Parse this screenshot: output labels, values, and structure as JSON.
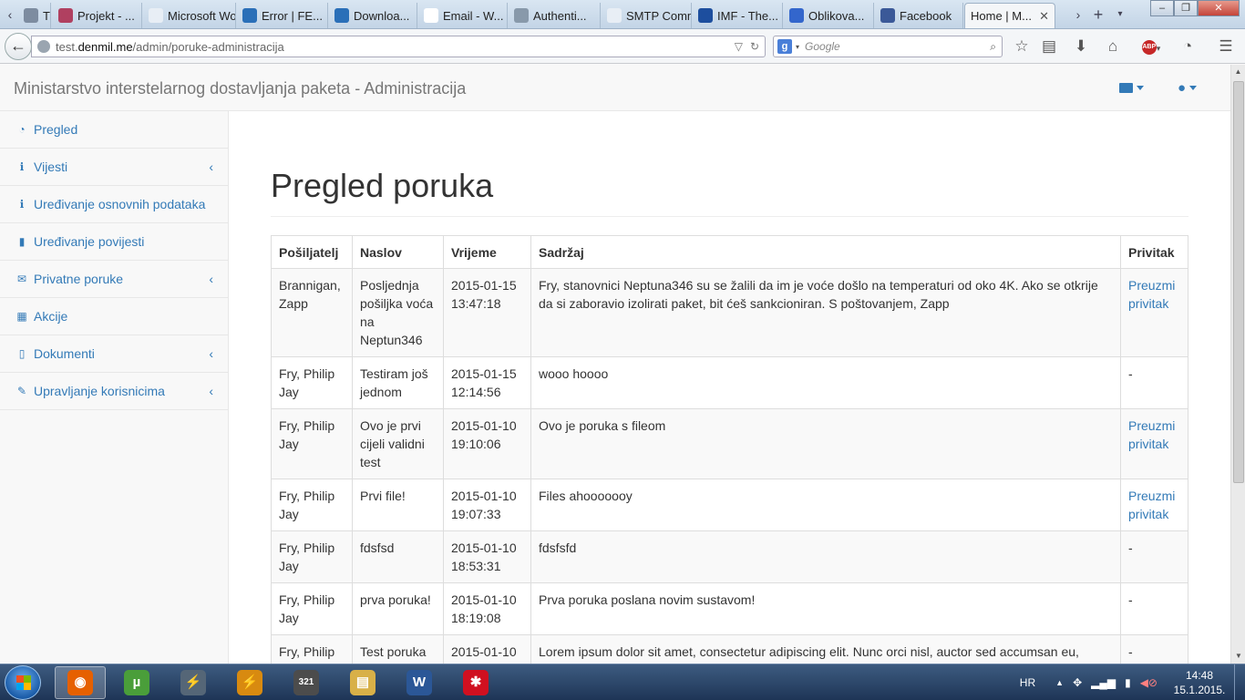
{
  "browser": {
    "tabs": [
      {
        "label": "Tr...",
        "icon": "generic-page-icon",
        "color": "#7d8ca0"
      },
      {
        "label": "Projekt - ...",
        "icon": "gear-icon",
        "color": "#b04060"
      },
      {
        "label": "Microsoft Wo...",
        "icon": "blank-page-icon",
        "color": "#e8eef5"
      },
      {
        "label": "Error | FE...",
        "icon": "circle-logo-icon",
        "color": "#2a6fb8"
      },
      {
        "label": "Downloa...",
        "icon": "circle-logo-icon",
        "color": "#2a6fb8"
      },
      {
        "label": "Email - W...",
        "icon": "wikipedia-icon",
        "color": "#ffffff"
      },
      {
        "label": "Authenti...",
        "icon": "tool-icon",
        "color": "#8899aa"
      },
      {
        "label": "SMTP Comm...",
        "icon": "blank-page-icon",
        "color": "#e8eef5"
      },
      {
        "label": "IMF - The...",
        "icon": "shark-fin-icon",
        "color": "#1d4e9e"
      },
      {
        "label": "Oblikova...",
        "icon": "f2-icon",
        "color": "#3366cc"
      },
      {
        "label": "Facebook",
        "icon": "facebook-icon",
        "color": "#3b5998"
      },
      {
        "label": "Home | M...",
        "icon": "",
        "color": ""
      }
    ],
    "url_prefix": "test.",
    "url_domain": "denmil.me",
    "url_path": "/admin/poruke-administracija",
    "search_placeholder": "Google"
  },
  "app": {
    "brand": "Ministarstvo interstelarnog dostavljanja paketa - Administracija"
  },
  "sidebar": {
    "items": [
      {
        "label": "Pregled",
        "icon": "dashboard-icon",
        "glyph": "◔",
        "expandable": false
      },
      {
        "label": "Vijesti",
        "icon": "info-icon",
        "glyph": "ℹ",
        "expandable": true
      },
      {
        "label": "Uređivanje osnovnih podataka",
        "icon": "info-icon",
        "glyph": "ℹ",
        "expandable": false
      },
      {
        "label": "Uređivanje povijesti",
        "icon": "book-icon",
        "glyph": "▮",
        "expandable": false
      },
      {
        "label": "Privatne poruke",
        "icon": "envelope-icon",
        "glyph": "✉",
        "expandable": true
      },
      {
        "label": "Akcije",
        "icon": "calendar-icon",
        "glyph": "▦",
        "expandable": false
      },
      {
        "label": "Dokumenti",
        "icon": "file-icon",
        "glyph": "▯",
        "expandable": true
      },
      {
        "label": "Upravljanje korisnicima",
        "icon": "wrench-icon",
        "glyph": "✎",
        "expandable": true
      }
    ]
  },
  "main": {
    "title": "Pregled poruka",
    "table": {
      "headers": [
        "Pošiljatelj",
        "Naslov",
        "Vrijeme",
        "Sadržaj",
        "Privitak"
      ],
      "rows": [
        {
          "sender": "Brannigan, Zapp",
          "subject": "Posljednja pošiljka voća na Neptun346",
          "time": "2015-01-15 13:47:18",
          "content": "Fry, stanovnici Neptuna346 su se žalili da im je voće došlo na temperaturi od oko 4K. Ako se otkrije da si zaboravio izolirati paket, bit ćeš sankcioniran. S poštovanjem, Zapp",
          "attachment": "Preuzmi privitak",
          "has_link": true
        },
        {
          "sender": "Fry, Philip Jay",
          "subject": "Testiram još jednom",
          "time": "2015-01-15 12:14:56",
          "content": "wooo hoooo",
          "attachment": "-",
          "has_link": false
        },
        {
          "sender": "Fry, Philip Jay",
          "subject": "Ovo je prvi cijeli validni test",
          "time": "2015-01-10 19:10:06",
          "content": "Ovo je poruka s fileom",
          "attachment": "Preuzmi privitak",
          "has_link": true
        },
        {
          "sender": "Fry, Philip Jay",
          "subject": "Prvi file!",
          "time": "2015-01-10 19:07:33",
          "content": "Files ahooooooy",
          "attachment": "Preuzmi privitak",
          "has_link": true
        },
        {
          "sender": "Fry, Philip Jay",
          "subject": "fdsfsd",
          "time": "2015-01-10 18:53:31",
          "content": "fdsfsfd",
          "attachment": "-",
          "has_link": false
        },
        {
          "sender": "Fry, Philip Jay",
          "subject": "prva poruka!",
          "time": "2015-01-10 18:19:08",
          "content": "Prva poruka poslana novim sustavom!",
          "attachment": "-",
          "has_link": false
        },
        {
          "sender": "Fry, Philip Jay",
          "subject": "Test poruka",
          "time": "2015-01-10",
          "content": "Lorem ipsum dolor sit amet, consectetur adipiscing elit. Nunc orci nisl, auctor sed accumsan eu,",
          "attachment": "-",
          "has_link": false
        }
      ]
    }
  },
  "taskbar": {
    "apps": [
      {
        "name": "firefox-app",
        "glyph": "◉",
        "color": "#e66000"
      },
      {
        "name": "utorrent-app",
        "glyph": "µ",
        "color": "#4a9e3a"
      },
      {
        "name": "network-tool-app",
        "glyph": "⚡",
        "color": "#556677"
      },
      {
        "name": "winamp-app",
        "glyph": "⚡",
        "color": "#d88a10"
      },
      {
        "name": "calendar-app",
        "glyph": "321",
        "color": "#4c4c4c"
      },
      {
        "name": "explorer-app",
        "glyph": "▤",
        "color": "#d8b048"
      },
      {
        "name": "word-app",
        "glyph": "W",
        "color": "#2b5797"
      },
      {
        "name": "splash-app",
        "glyph": "✱",
        "color": "#d01020"
      }
    ],
    "language": "HR",
    "time": "14:48",
    "date": "15.1.2015."
  }
}
